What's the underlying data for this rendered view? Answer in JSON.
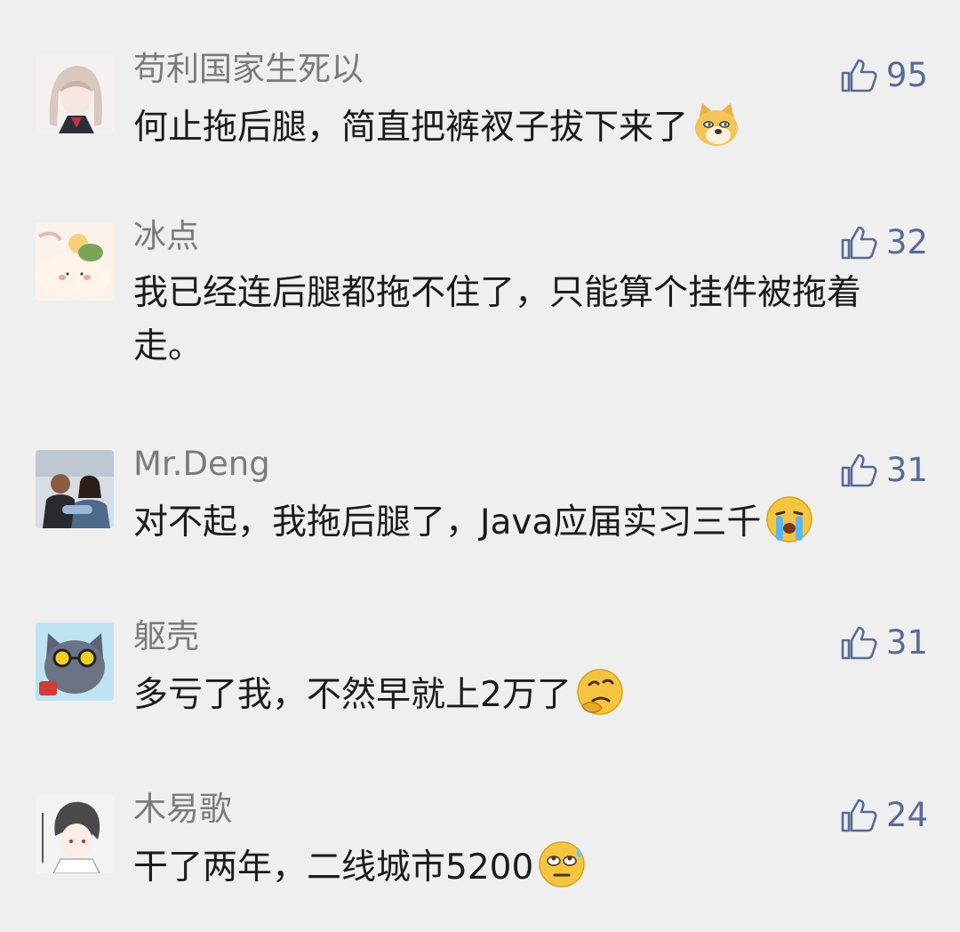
{
  "comments": [
    {
      "name": "苟利国家生死以",
      "text": "何止拖后腿，简直把裤衩子拔下来了",
      "likes": "95",
      "emoji": "doge-emoji",
      "like_icon": "thumbs-up-icon"
    },
    {
      "name": "冰点",
      "text": "我已经连后腿都拖不住了，只能算个挂件被拖着走。",
      "likes": "32",
      "emoji": "",
      "like_icon": "thumbs-up-icon"
    },
    {
      "name": "Mr.Deng",
      "text": "对不起，我拖后腿了，Java应届实习三千",
      "likes": "31",
      "emoji": "crying-face-emoji",
      "like_icon": "thumbs-up-icon"
    },
    {
      "name": "躯壳",
      "text": "多亏了我，不然早就上2万了",
      "likes": "31",
      "emoji": "thinking-face-emoji",
      "like_icon": "thumbs-up-icon"
    },
    {
      "name": "木易歌",
      "text": "干了两年，二线城市5200",
      "likes": "24",
      "emoji": "eye-roll-sweat-emoji",
      "like_icon": "thumbs-up-icon"
    }
  ],
  "colors": {
    "background": "#efefef",
    "name": "#7b7b7b",
    "text": "#1b1b1b",
    "like": "#576b95"
  }
}
